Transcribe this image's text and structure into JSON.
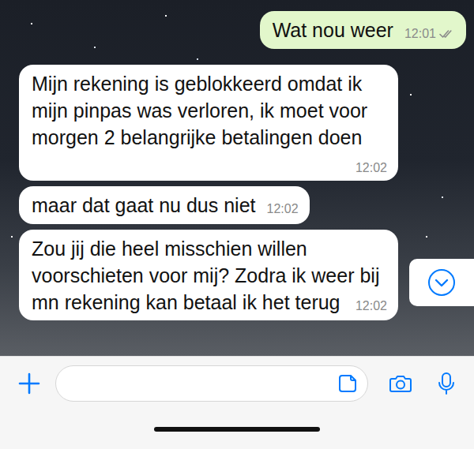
{
  "chat": {
    "messages": [
      {
        "kind": "outgoing",
        "text": "Wat nou weer",
        "time": "12:01",
        "read": false
      },
      {
        "kind": "incoming",
        "text": "Mijn rekening is geblokkeerd omdat ik mijn pinpas was verloren, ik moet voor morgen 2 belangrijke betalingen doen",
        "time": "12:02"
      },
      {
        "kind": "incoming",
        "text": "maar dat gaat nu dus niet",
        "time": "12:02"
      },
      {
        "kind": "incoming",
        "text": "Zou jij die heel misschien willen voorschieten voor mij? Zodra ik weer bij mn rekening kan betaal ik het terug",
        "time": "12:02"
      }
    ]
  }
}
